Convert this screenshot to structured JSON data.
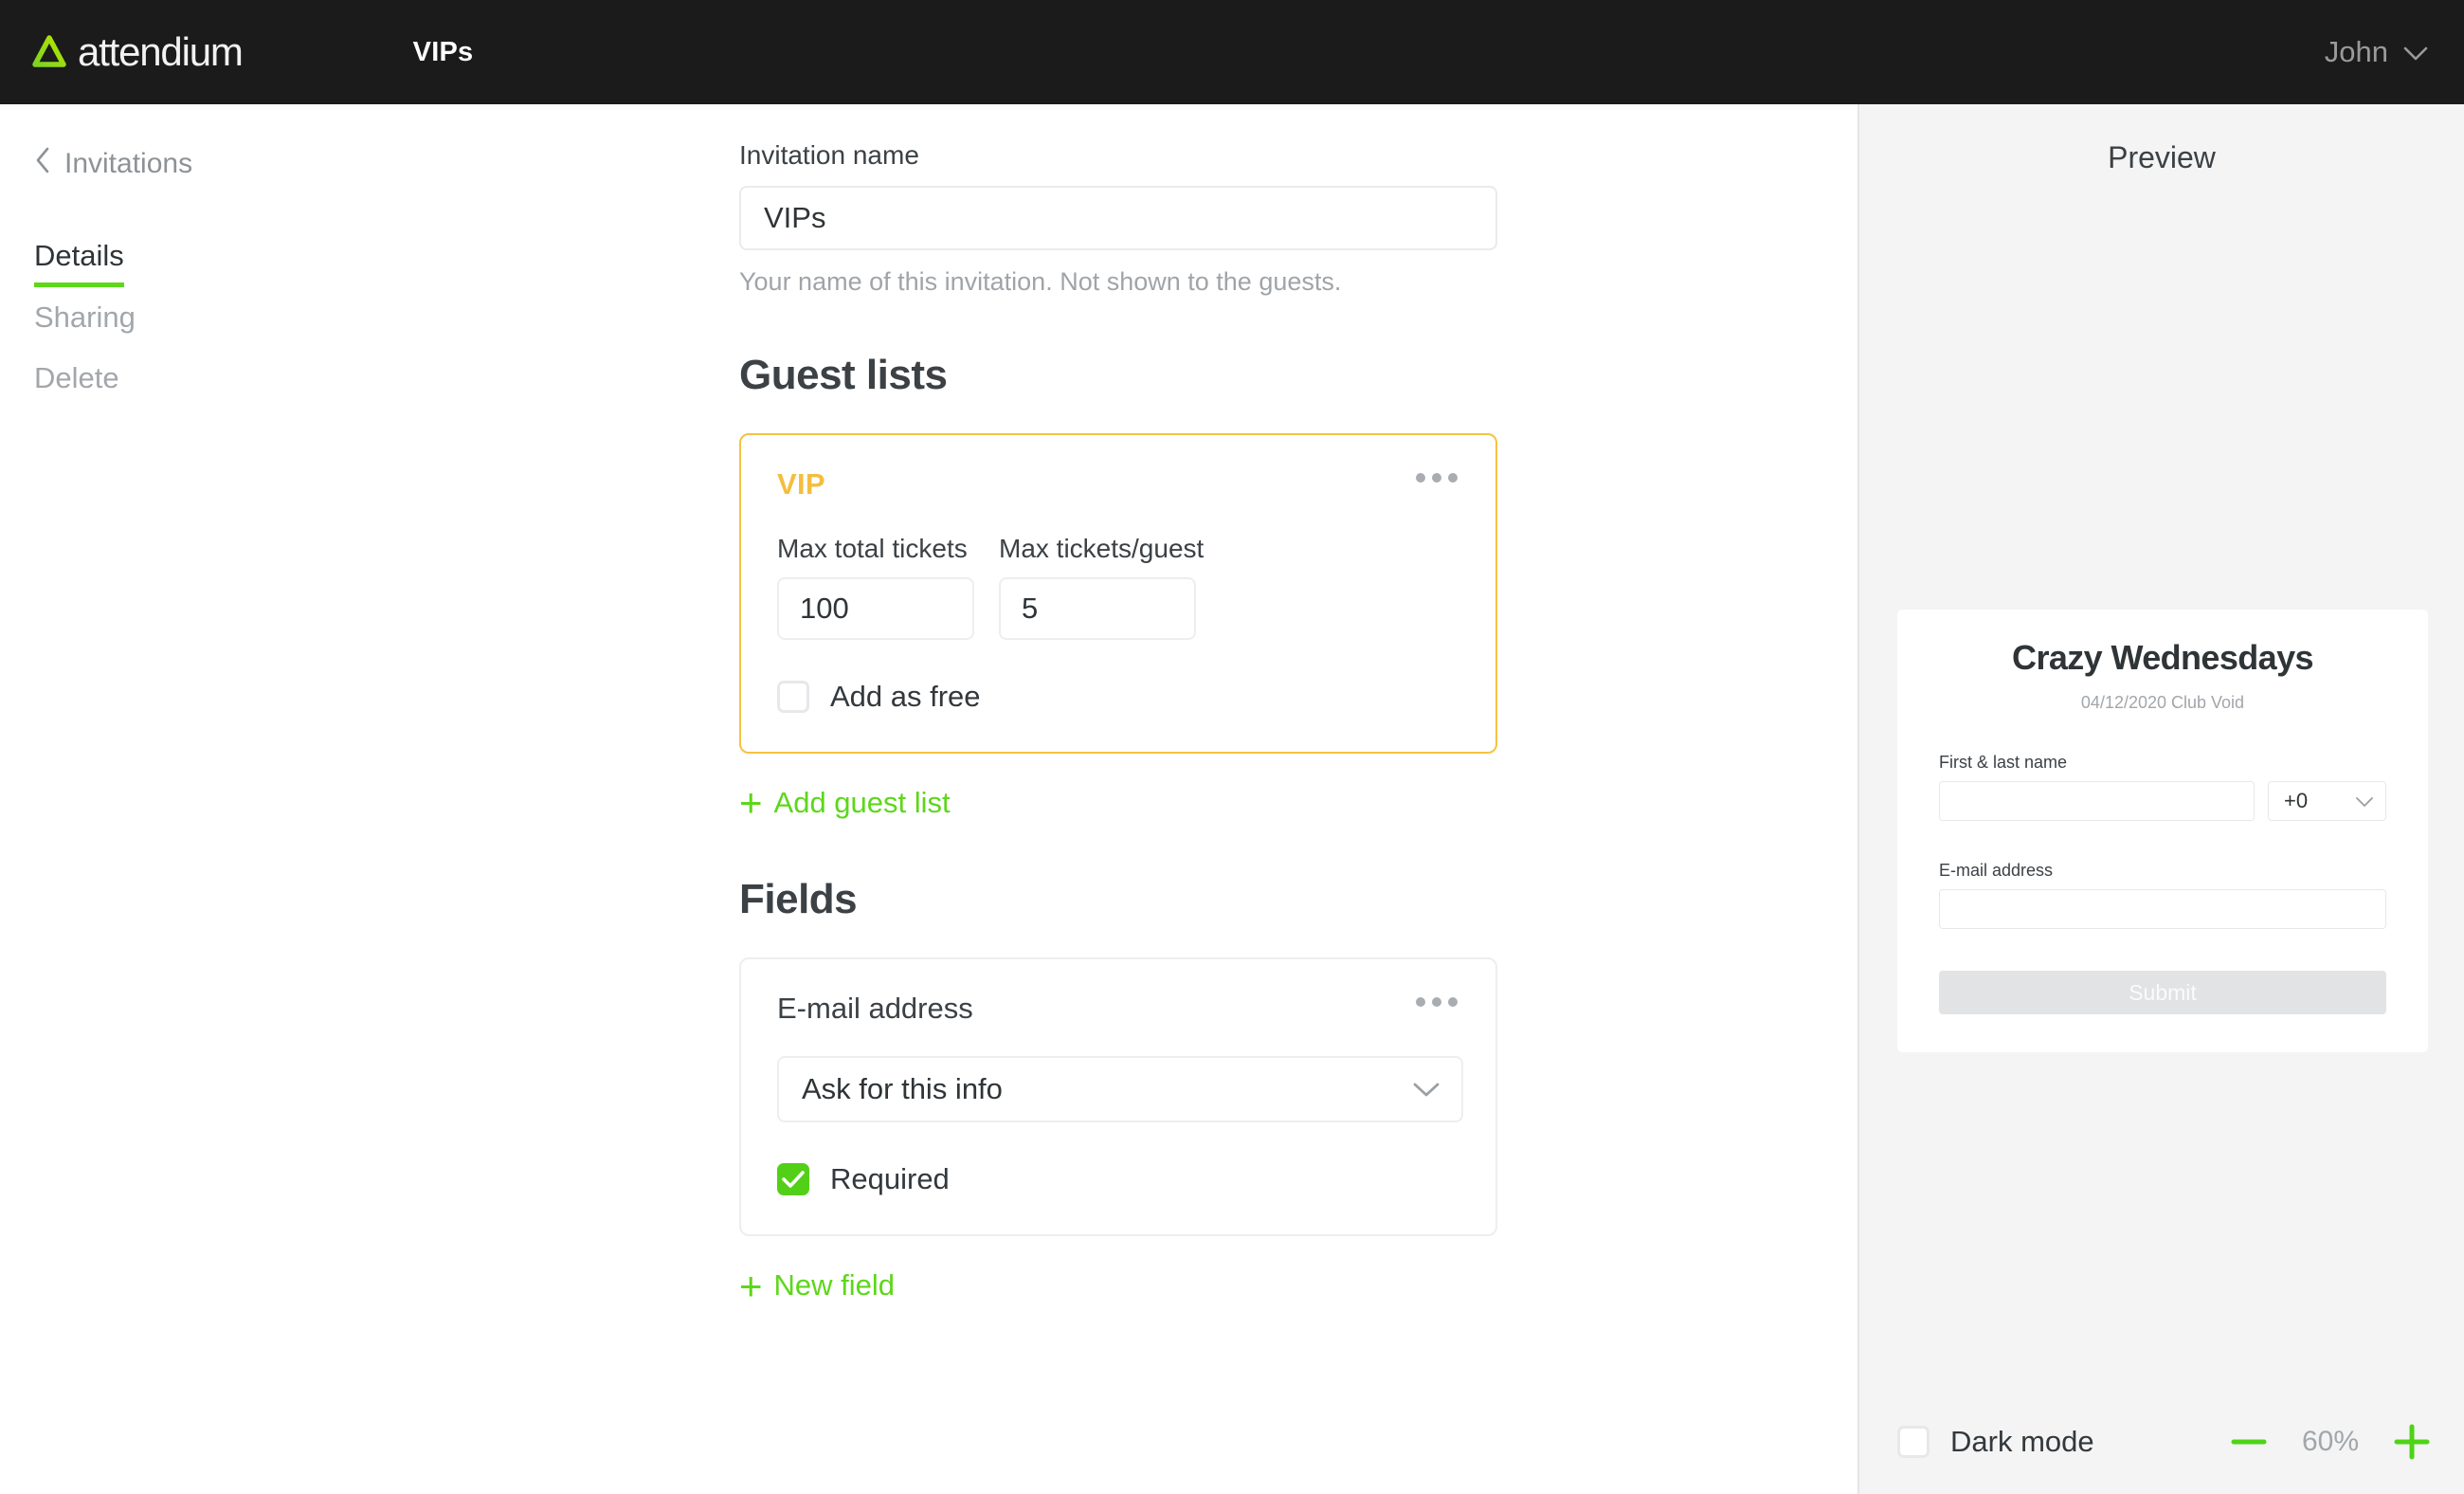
{
  "header": {
    "brand_name": "attendium",
    "brand_icon": "attendium-triangle-logo",
    "nav_item": "VIPs",
    "user_name": "John",
    "user_chevron_icon": "chevron-down-icon",
    "bg_color": "#1b1b1b"
  },
  "sidebar": {
    "back_icon": "chevron-left-icon",
    "back_label": "Invitations",
    "items": [
      {
        "label": "Details",
        "active": true
      },
      {
        "label": "Sharing",
        "active": false
      },
      {
        "label": "Delete",
        "active": false
      }
    ],
    "active_underline_color": "#5dd71a"
  },
  "main": {
    "invitation_name": {
      "label": "Invitation name",
      "value": "VIPs",
      "placeholder": "Invitation name",
      "helper": "Your name of this invitation. Not shown to the guests."
    },
    "guest_lists": {
      "title": "Guest lists",
      "cards": [
        {
          "name": "VIP",
          "name_color": "#f4be3c",
          "border_color": "#f6c242",
          "kebab_icon": "more-options-icon",
          "max_total_tickets_label": "Max total tickets",
          "max_total_tickets_value": "100",
          "max_tickets_guest_label": "Max tickets/guest",
          "max_tickets_guest_value": "5",
          "add_as_free_label": "Add as free",
          "add_as_free_checked": false
        }
      ],
      "add_link": "Add guest list",
      "add_icon": "plus-icon"
    },
    "fields": {
      "title": "Fields",
      "cards": [
        {
          "name": "E-mail address",
          "kebab_icon": "more-options-icon",
          "select_value": "Ask for this info",
          "select_chevron_icon": "chevron-down-icon",
          "required_label": "Required",
          "required_checked": true
        }
      ],
      "add_link": "New field",
      "add_icon": "plus-icon"
    },
    "accent_green": "#5dd71a"
  },
  "preview": {
    "title": "Preview",
    "card": {
      "event_title": "Crazy Wednesdays",
      "event_subtitle": "04/12/2020 Club Void",
      "name_label": "First & last name",
      "name_value": "",
      "country_code": "+0",
      "country_chevron_icon": "chevron-down-icon",
      "email_label": "E-mail address",
      "email_value": "",
      "submit_label": "Submit"
    },
    "bottom_bar": {
      "dark_mode_label": "Dark mode",
      "dark_mode_checked": false,
      "zoom_out_icon": "minus-icon",
      "zoom_in_icon": "plus-icon",
      "zoom_value": "60%"
    }
  }
}
